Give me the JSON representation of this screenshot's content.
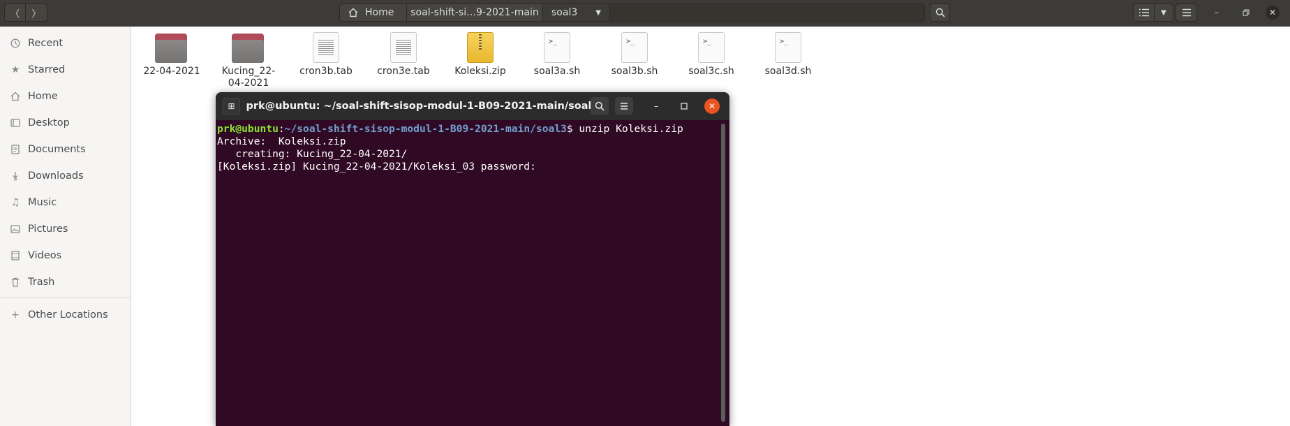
{
  "header": {
    "back_icon": "chevron-left-icon",
    "forward_icon": "chevron-right-icon",
    "breadcrumbs": [
      "Home",
      "soal-shift-si…9-2021-main",
      "soal3"
    ],
    "search_icon": "search-icon",
    "view_icon": "list-view-icon",
    "menu_icon": "hamburger-menu-icon"
  },
  "sidebar": {
    "items": [
      {
        "label": "Recent",
        "icon": "clock-icon"
      },
      {
        "label": "Starred",
        "icon": "star-icon"
      },
      {
        "label": "Home",
        "icon": "home-icon"
      },
      {
        "label": "Desktop",
        "icon": "desktop-icon"
      },
      {
        "label": "Documents",
        "icon": "document-icon"
      },
      {
        "label": "Downloads",
        "icon": "download-icon"
      },
      {
        "label": "Music",
        "icon": "music-icon"
      },
      {
        "label": "Pictures",
        "icon": "picture-icon"
      },
      {
        "label": "Videos",
        "icon": "video-icon"
      },
      {
        "label": "Trash",
        "icon": "trash-icon"
      }
    ],
    "other_locations": "Other Locations"
  },
  "files": [
    {
      "name": "22-04-2021",
      "type": "folder"
    },
    {
      "name": "Kucing_22-04-2021",
      "type": "folder"
    },
    {
      "name": "cron3b.tab",
      "type": "text"
    },
    {
      "name": "cron3e.tab",
      "type": "text"
    },
    {
      "name": "Koleksi.zip",
      "type": "zip"
    },
    {
      "name": "soal3a.sh",
      "type": "script"
    },
    {
      "name": "soal3b.sh",
      "type": "script"
    },
    {
      "name": "soal3c.sh",
      "type": "script"
    },
    {
      "name": "soal3d.sh",
      "type": "script"
    }
  ],
  "terminal": {
    "title": "prk@ubuntu: ~/soal-shift-sisop-modul-1-B09-2021-main/soal3",
    "prompt_user": "prk@ubuntu",
    "prompt_sep": ":",
    "prompt_path": "~/soal-shift-sisop-modul-1-B09-2021-main/soal3",
    "command": "$ unzip Koleksi.zip",
    "output": [
      "Archive:  Koleksi.zip",
      "   creating: Kucing_22-04-2021/",
      "[Koleksi.zip] Kucing_22-04-2021/Koleksi_03 password:"
    ],
    "colors": {
      "background": "#300a24",
      "user": "#8ae234",
      "path": "#729fcf",
      "close": "#e95420"
    }
  }
}
